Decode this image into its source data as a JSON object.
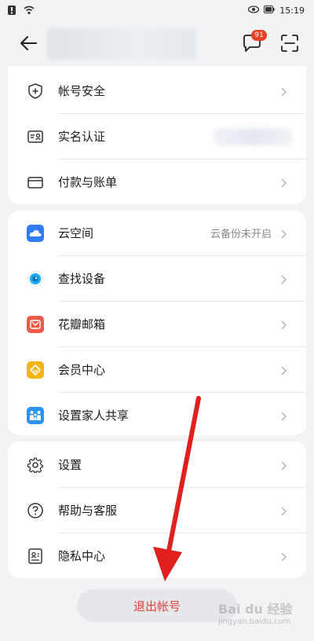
{
  "status_bar": {
    "time": "15:19"
  },
  "header": {
    "badge_count": "91"
  },
  "account": [
    {
      "label": "帐号安全"
    },
    {
      "label": "实名认证"
    },
    {
      "label": "付款与账单"
    }
  ],
  "services": [
    {
      "label": "云空间",
      "value": "云备份未开启",
      "icon_color": "#2f7cf6"
    },
    {
      "label": "查找设备",
      "icon_color": "#1da8f0"
    },
    {
      "label": "花瓣邮箱",
      "icon_color": "#ee5a48"
    },
    {
      "label": "会员中心",
      "icon_color": "#f2b515"
    },
    {
      "label": "设置家人共享",
      "icon_color": "#2d93f0"
    }
  ],
  "general": [
    {
      "label": "设置"
    },
    {
      "label": "帮助与客服"
    },
    {
      "label": "隐私中心"
    }
  ],
  "logout_label": "退出帐号",
  "watermark": {
    "brand": "Bai du 经验",
    "url": "jingyan.baidu.com"
  },
  "colors": {
    "accent_red": "#e0403a",
    "annotation_arrow": "#e01f1f"
  }
}
